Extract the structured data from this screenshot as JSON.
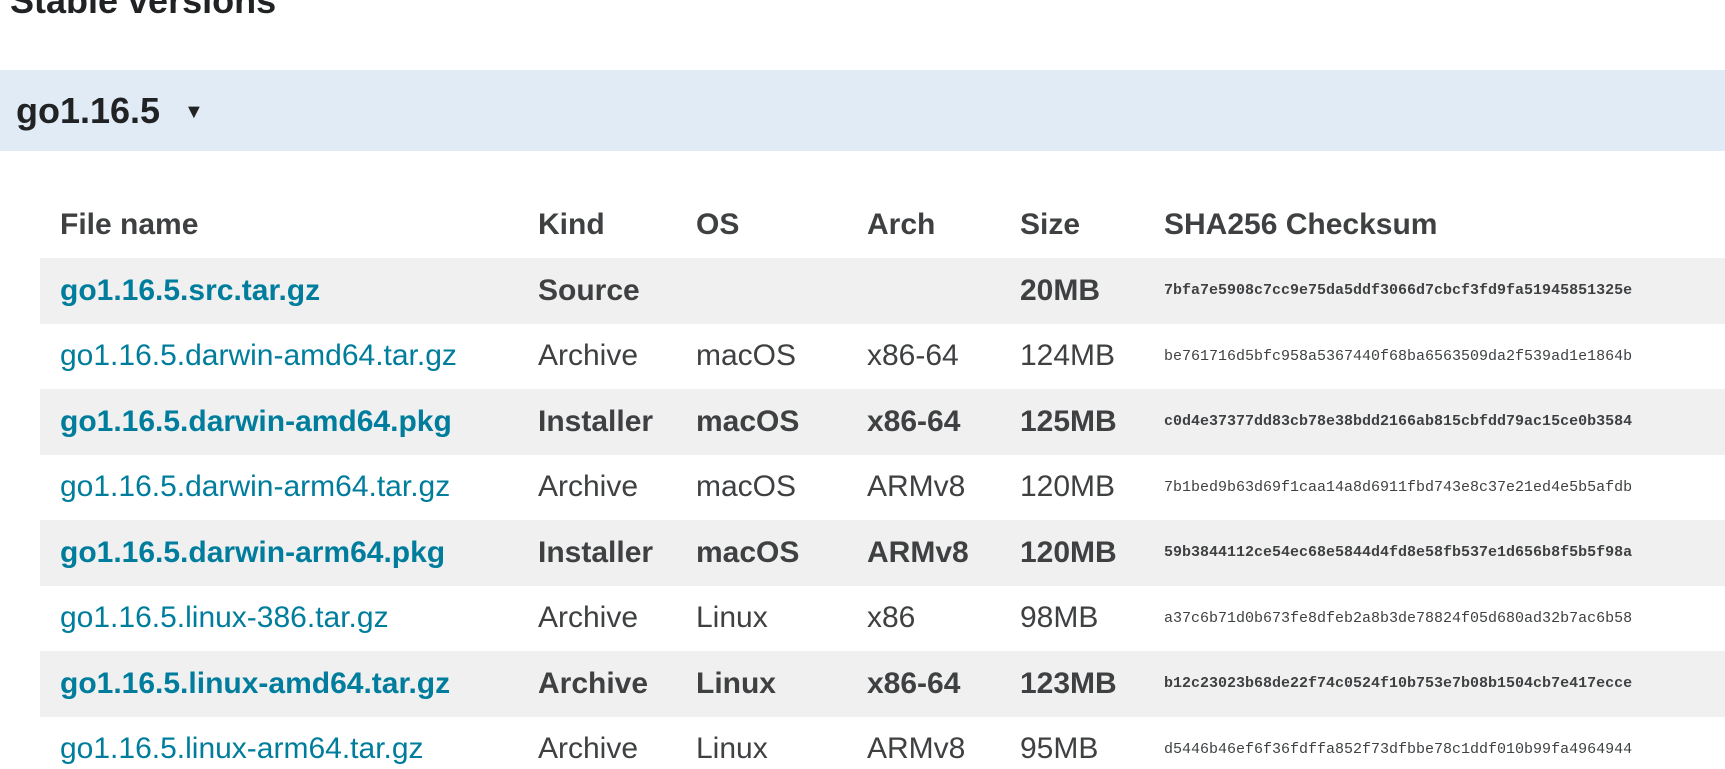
{
  "section": {
    "title": "Stable versions"
  },
  "version": {
    "label": "go1.16.5",
    "caret": "▼"
  },
  "table": {
    "headers": [
      "File name",
      "Kind",
      "OS",
      "Arch",
      "Size",
      "SHA256 Checksum"
    ],
    "rows": [
      {
        "file": "go1.16.5.src.tar.gz",
        "kind": "Source",
        "os": "",
        "arch": "",
        "size": "20MB",
        "checksum": "7bfa7e5908c7cc9e75da5ddf3066d7cbcf3fd9fa51945851325e",
        "highlight": true
      },
      {
        "file": "go1.16.5.darwin-amd64.tar.gz",
        "kind": "Archive",
        "os": "macOS",
        "arch": "x86-64",
        "size": "124MB",
        "checksum": "be761716d5bfc958a5367440f68ba6563509da2f539ad1e1864b",
        "highlight": false
      },
      {
        "file": "go1.16.5.darwin-amd64.pkg",
        "kind": "Installer",
        "os": "macOS",
        "arch": "x86-64",
        "size": "125MB",
        "checksum": "c0d4e37377dd83cb78e38bdd2166ab815cbfdd79ac15ce0b3584",
        "highlight": true
      },
      {
        "file": "go1.16.5.darwin-arm64.tar.gz",
        "kind": "Archive",
        "os": "macOS",
        "arch": "ARMv8",
        "size": "120MB",
        "checksum": "7b1bed9b63d69f1caa14a8d6911fbd743e8c37e21ed4e5b5afdb",
        "highlight": false
      },
      {
        "file": "go1.16.5.darwin-arm64.pkg",
        "kind": "Installer",
        "os": "macOS",
        "arch": "ARMv8",
        "size": "120MB",
        "checksum": "59b3844112ce54ec68e5844d4fd8e58fb537e1d656b8f5b5f98a",
        "highlight": true
      },
      {
        "file": "go1.16.5.linux-386.tar.gz",
        "kind": "Archive",
        "os": "Linux",
        "arch": "x86",
        "size": "98MB",
        "checksum": "a37c6b71d0b673fe8dfeb2a8b3de78824f05d680ad32b7ac6b58",
        "highlight": false
      },
      {
        "file": "go1.16.5.linux-amd64.tar.gz",
        "kind": "Archive",
        "os": "Linux",
        "arch": "x86-64",
        "size": "123MB",
        "checksum": "b12c23023b68de22f74c0524f10b753e7b08b1504cb7e417ecce",
        "highlight": true
      },
      {
        "file": "go1.16.5.linux-arm64.tar.gz",
        "kind": "Archive",
        "os": "Linux",
        "arch": "ARMv8",
        "size": "95MB",
        "checksum": "d5446b46ef6f36fdffa852f73dfbbe78c1ddf010b99fa4964944",
        "highlight": false
      }
    ]
  }
}
